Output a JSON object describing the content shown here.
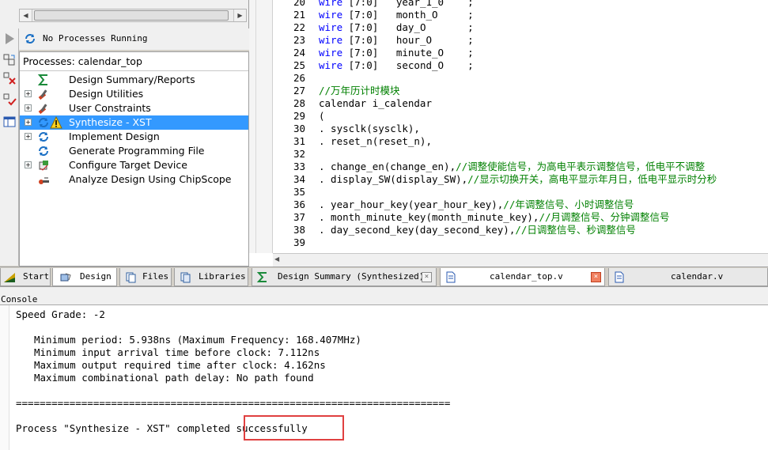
{
  "status": {
    "processes_text": "No Processes Running"
  },
  "processes": {
    "header": "Processes: calendar_top",
    "items": [
      {
        "label": "Design Summary/Reports",
        "expander": false,
        "icon": "sigma-icon"
      },
      {
        "label": "Design Utilities",
        "expander": true,
        "icon": "tools-icon"
      },
      {
        "label": "User Constraints",
        "expander": true,
        "icon": "tools-icon"
      },
      {
        "label": "Synthesize - XST",
        "expander": true,
        "icon": "refresh-icon",
        "warning": true,
        "selected": true
      },
      {
        "label": "Implement Design",
        "expander": true,
        "icon": "refresh-icon"
      },
      {
        "label": "Generate Programming File",
        "expander": false,
        "icon": "refresh-icon"
      },
      {
        "label": "Configure Target Device",
        "expander": true,
        "icon": "chip-icon"
      },
      {
        "label": "Analyze Design Using ChipScope",
        "expander": false,
        "icon": "probe-icon"
      }
    ]
  },
  "left_tabs": [
    {
      "label": "Start",
      "icon": "start-icon"
    },
    {
      "label": "Design",
      "icon": "design-icon",
      "active": true
    },
    {
      "label": "Files",
      "icon": "files-icon"
    },
    {
      "label": "Libraries",
      "icon": "libraries-icon"
    }
  ],
  "editor": {
    "lines": [
      {
        "n": "20",
        "kw": "wire",
        "rest": " [7:0]   year_1_0    ;"
      },
      {
        "n": "21",
        "kw": "wire",
        "rest": " [7:0]   month_O     ;"
      },
      {
        "n": "22",
        "kw": "wire",
        "rest": " [7:0]   day_O       ;"
      },
      {
        "n": "23",
        "kw": "wire",
        "rest": " [7:0]   hour_O      ;"
      },
      {
        "n": "24",
        "kw": "wire",
        "rest": " [7:0]   minute_O    ;"
      },
      {
        "n": "25",
        "kw": "wire",
        "rest": " [7:0]   second_O    ;"
      },
      {
        "n": "26",
        "kw": "",
        "rest": ""
      },
      {
        "n": "27",
        "kw": "",
        "rest": "",
        "comment": "//万年历计时模块"
      },
      {
        "n": "28",
        "kw": "",
        "rest": "calendar i_calendar"
      },
      {
        "n": "29",
        "kw": "",
        "rest": "("
      },
      {
        "n": "30",
        "kw": "",
        "rest": ". sysclk(sysclk),"
      },
      {
        "n": "31",
        "kw": "",
        "rest": ". reset_n(reset_n),"
      },
      {
        "n": "32",
        "kw": "",
        "rest": ""
      },
      {
        "n": "33",
        "kw": "",
        "rest": ". change_en(change_en),",
        "comment": "//调整使能信号，为高电平表示调整信号，低电平不调整"
      },
      {
        "n": "34",
        "kw": "",
        "rest": ". display_SW(display_SW),",
        "comment": "//显示切换开关，高电平显示年月日，低电平显示时分秒"
      },
      {
        "n": "35",
        "kw": "",
        "rest": ""
      },
      {
        "n": "36",
        "kw": "",
        "rest": ". year_hour_key(year_hour_key),",
        "comment": "//年调整信号、小时调整信号"
      },
      {
        "n": "37",
        "kw": "",
        "rest": ". month_minute_key(month_minute_key),",
        "comment": "//月调整信号、分钟调整信号"
      },
      {
        "n": "38",
        "kw": "",
        "rest": ". day_second_key(day_second_key),",
        "comment": "//日调整信号、秒调整信号"
      },
      {
        "n": "39",
        "kw": "",
        "rest": ""
      }
    ]
  },
  "editor_tabs": [
    {
      "label": "Design Summary (Synthesized)",
      "icon": "sigma-icon"
    },
    {
      "label": "calendar_top.v",
      "icon": "file-icon",
      "active": true
    },
    {
      "label": "calendar.v",
      "icon": "file-icon"
    }
  ],
  "console": {
    "title": "Console",
    "lines": [
      "Speed Grade: -2",
      "Minimum period: 5.938ns (Maximum Frequency: 168.407MHz)",
      "Minimum input arrival time before clock: 7.112ns",
      "Maximum output required time after clock: 4.162ns",
      "Maximum combinational path delay: No path found",
      "=========================================================================",
      "Process \"Synthesize - XST\" completed successfully"
    ]
  },
  "colors": {
    "selection": "#3399ff",
    "keyword": "#0000ff",
    "comment": "#008000",
    "highlight_box": "#e04040"
  }
}
